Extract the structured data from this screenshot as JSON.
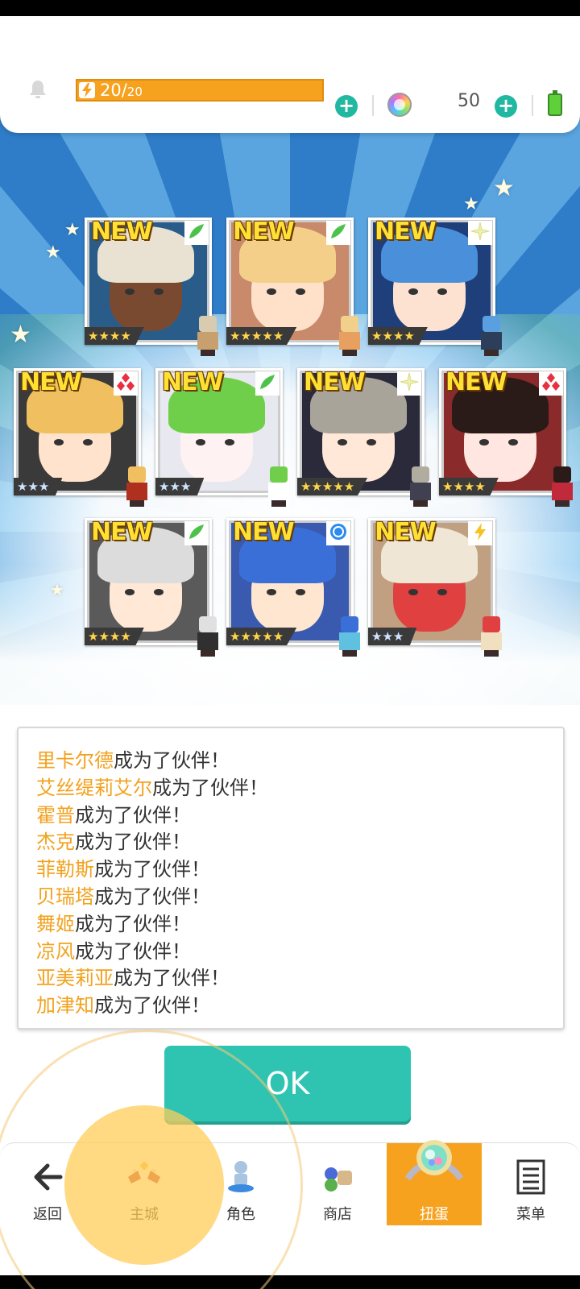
{
  "topbar": {
    "stamina_current": "20/",
    "stamina_max": "20",
    "plus_symbol": "+",
    "gem_count": "50"
  },
  "cards": [
    {
      "badge": "NEW",
      "element": "leaf",
      "rarity": "★★★★",
      "hair": "#e9e2d2",
      "skin": "#7a4a30",
      "bg": "#2a5c8a",
      "sprite_head": "#d8cbb0",
      "sprite_body": "#c8a070"
    },
    {
      "badge": "NEW",
      "element": "leaf",
      "rarity": "★★★★★",
      "hair": "#f3cf8a",
      "skin": "#ffe0c8",
      "bg": "#c88a6a",
      "sprite_head": "#f0d08a",
      "sprite_body": "#e8a060"
    },
    {
      "badge": "NEW",
      "element": "light",
      "rarity": "★★★★",
      "hair": "#4a8fd9",
      "skin": "#fde2d2",
      "bg": "#1e3f7a",
      "sprite_head": "#5aa0e0",
      "sprite_body": "#2c3e5a"
    },
    {
      "badge": "NEW",
      "element": "fire",
      "rarity": "★★★",
      "hair": "#f0c060",
      "skin": "#ffe3cc",
      "bg": "#3a3a3a",
      "sprite_head": "#f0c060",
      "sprite_body": "#b03020"
    },
    {
      "badge": "NEW",
      "element": "leaf",
      "rarity": "★★★",
      "hair": "#6fcf4a",
      "skin": "#fff2f2",
      "bg": "#e8e8f0",
      "sprite_head": "#6fcf4a",
      "sprite_body": "#ffffff"
    },
    {
      "badge": "NEW",
      "element": "light",
      "rarity": "★★★★★",
      "hair": "#a8a49a",
      "skin": "#ffe8d8",
      "bg": "#2a2a3a",
      "sprite_head": "#b0aca0",
      "sprite_body": "#404050"
    },
    {
      "badge": "NEW",
      "element": "fire",
      "rarity": "★★★★",
      "hair": "#2a1a18",
      "skin": "#ffe6e0",
      "bg": "#8a2a2a",
      "sprite_head": "#2a1a18",
      "sprite_body": "#c02a3a"
    },
    {
      "badge": "NEW",
      "element": "leaf",
      "rarity": "★★★★",
      "hair": "#dcdcdc",
      "skin": "#ffe8d6",
      "bg": "#5a5a5a",
      "sprite_head": "#e0e0e0",
      "sprite_body": "#303030"
    },
    {
      "badge": "NEW",
      "element": "water",
      "rarity": "★★★★★",
      "hair": "#3a6fd8",
      "skin": "#ffe6d0",
      "bg": "#3a5ab0",
      "sprite_head": "#3a6fd8",
      "sprite_body": "#60c0e0"
    },
    {
      "badge": "NEW",
      "element": "thunder",
      "rarity": "★★★",
      "hair": "#efe6d6",
      "skin": "#e04040",
      "bg": "#c0a080",
      "sprite_head": "#e04040",
      "sprite_body": "#f0e0c0"
    }
  ],
  "messages": [
    {
      "name": "里卡尔德",
      "suffix": "成为了伙伴！"
    },
    {
      "name": "艾丝缇莉艾尔",
      "suffix": "成为了伙伴！"
    },
    {
      "name": "霍普",
      "suffix": "成为了伙伴！"
    },
    {
      "name": "杰克",
      "suffix": "成为了伙伴！"
    },
    {
      "name": "菲勒斯",
      "suffix": "成为了伙伴！"
    },
    {
      "name": "贝瑞塔",
      "suffix": "成为了伙伴！"
    },
    {
      "name": "舞姬",
      "suffix": "成为了伙伴！"
    },
    {
      "name": "凉风",
      "suffix": "成为了伙伴！"
    },
    {
      "name": "亚美莉亚",
      "suffix": "成为了伙伴！"
    },
    {
      "name": "加津知",
      "suffix": "成为了伙伴！"
    }
  ],
  "ok_button": {
    "label": "OK"
  },
  "nav": {
    "back": "返回",
    "main_city": "主城",
    "character": "角色",
    "shop": "商店",
    "gacha": "扭蛋",
    "menu": "菜单"
  },
  "colors": {
    "accent_teal": "#2fc4b2",
    "accent_orange": "#f7a21e",
    "name_orange": "#f2a21e"
  },
  "icons": [
    "bell-icon",
    "lightning-icon",
    "plus-icon",
    "rainbow-gem-icon",
    "battery-icon",
    "back-arrow-icon",
    "castle-icon",
    "character-icon",
    "shop-icon",
    "gacha-icon",
    "menu-icon"
  ]
}
